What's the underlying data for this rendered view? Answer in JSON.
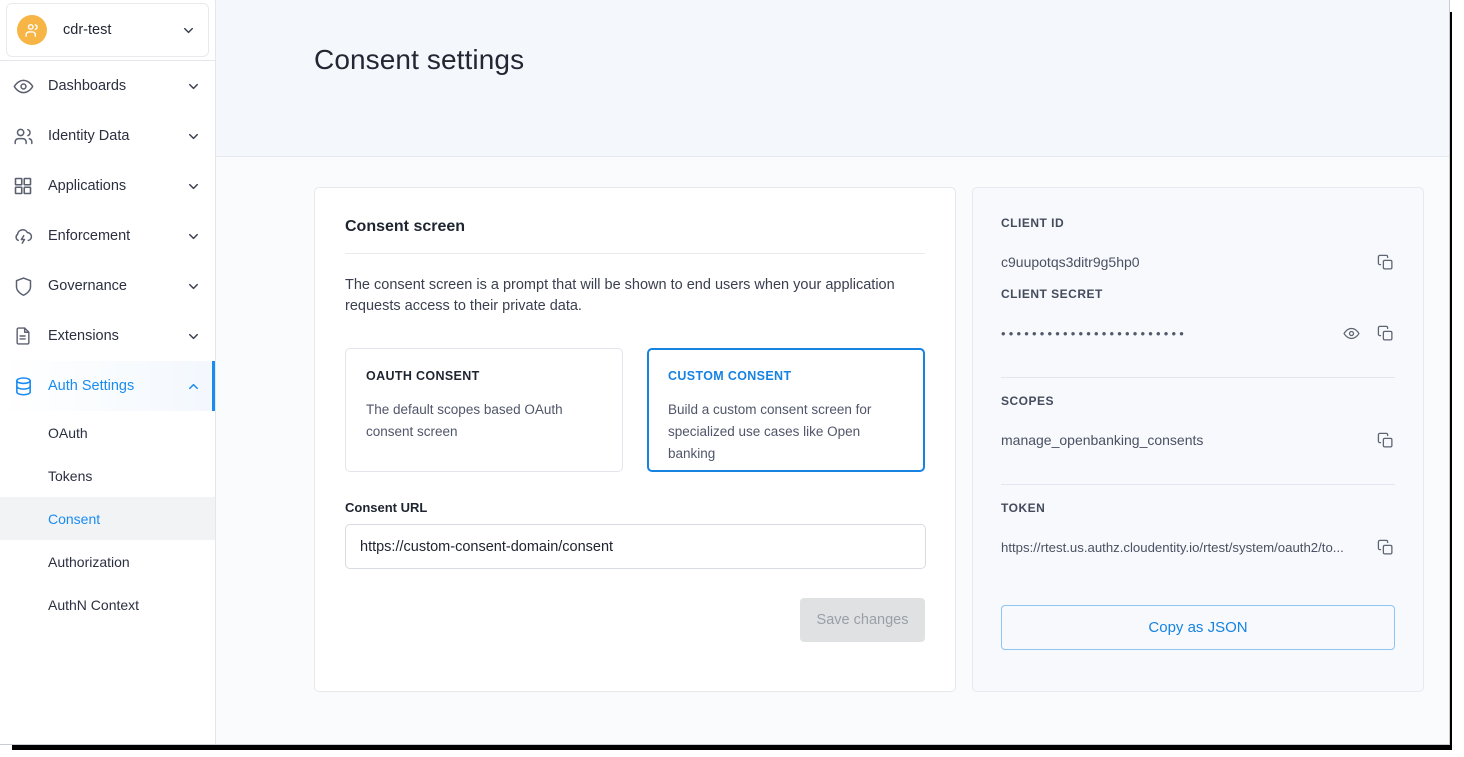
{
  "window": {
    "title": "Consent settings"
  },
  "sidebar": {
    "org": {
      "name": "cdr-test",
      "avatar_icon": "people-avatar-icon",
      "chevron_icon": "chevron-down-icon",
      "avatar_color": "#f6b545"
    },
    "items": [
      {
        "label": "Dashboards",
        "icon": "eye-icon",
        "chevron": "chevron-down-icon",
        "active": false
      },
      {
        "label": "Identity Data",
        "icon": "people-icon",
        "chevron": "chevron-down-icon",
        "active": false
      },
      {
        "label": "Applications",
        "icon": "grid-icon",
        "chevron": "chevron-down-icon",
        "active": false
      },
      {
        "label": "Enforcement",
        "icon": "cloud-lightning-icon",
        "chevron": "chevron-down-icon",
        "active": false
      },
      {
        "label": "Governance",
        "icon": "shield-icon",
        "chevron": "chevron-down-icon",
        "active": false
      },
      {
        "label": "Extensions",
        "icon": "document-icon",
        "chevron": "chevron-down-icon",
        "active": false
      },
      {
        "label": "Auth Settings",
        "icon": "database-icon",
        "chevron": "chevron-up-icon",
        "active": true
      }
    ],
    "subitems": [
      {
        "label": "OAuth",
        "active": false
      },
      {
        "label": "Tokens",
        "active": false
      },
      {
        "label": "Consent",
        "active": true
      },
      {
        "label": "Authorization",
        "active": false
      },
      {
        "label": "AuthN Context",
        "active": false
      }
    ],
    "accent_color": "#1a8cf0"
  },
  "main": {
    "consent_card": {
      "title": "Consent screen",
      "description": "The consent screen is a prompt that will be shown to end users when your application requests access to their private data.",
      "options": [
        {
          "title": "OAUTH CONSENT",
          "description": "The default scopes based OAuth consent screen",
          "selected": false
        },
        {
          "title": "CUSTOM CONSENT",
          "description": "Build a custom consent screen for specialized use cases like Open banking",
          "selected": true
        }
      ],
      "consent_url_label": "Consent URL",
      "consent_url_value": "https://custom-consent-domain/consent",
      "consent_url_placeholder": "https://custom-consent-domain/consent",
      "save_label": "Save changes",
      "save_disabled": true,
      "selected_color": "#1683e2"
    },
    "credentials_panel": {
      "client_id_label": "CLIENT ID",
      "client_id_value": "c9uupotqs3ditr9g5hp0",
      "client_secret_label": "CLIENT SECRET",
      "client_secret_masked": "••••••••••••••••••••••••",
      "scopes_label": "SCOPES",
      "scopes_value": "manage_openbanking_consents",
      "token_label": "TOKEN",
      "token_value": "https://rtest.us.authz.cloudentity.io/rtest/system/oauth2/to...",
      "copy_json_label": "Copy as JSON",
      "copy_icon": "copy-icon",
      "reveal_icon": "eye-icon",
      "link_color": "#1683e2"
    }
  }
}
